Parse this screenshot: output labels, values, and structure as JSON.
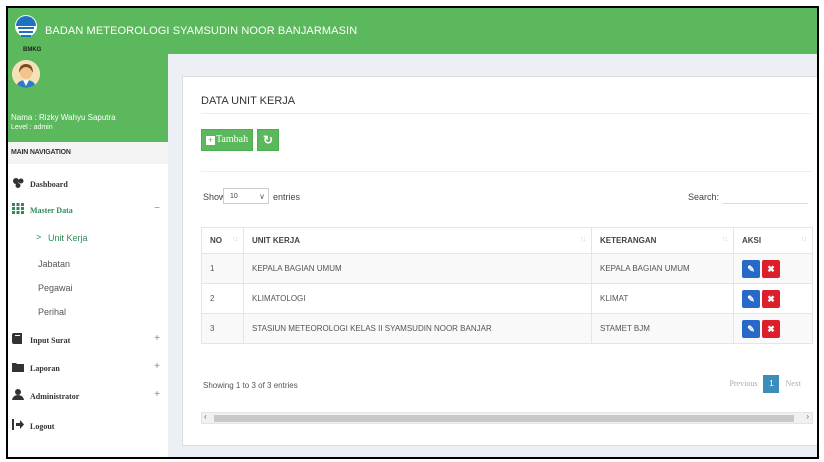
{
  "header": {
    "logo_text": "BMKG",
    "title": "BADAN METEOROLOGI SYAMSUDIN NOOR BANJARMASIN"
  },
  "user": {
    "name": "Nama : Rizky Wahyu Saputra",
    "level": "Level : admin"
  },
  "sidebar": {
    "nav_header": "MAIN NAVIGATION",
    "items": [
      {
        "label": "Dashboard",
        "icon": "dashboard-icon"
      },
      {
        "label": "Master Data",
        "icon": "grid-icon",
        "toggle": "−"
      },
      {
        "label": "Input Surat",
        "icon": "book-icon",
        "toggle": "+"
      },
      {
        "label": "Laporan",
        "icon": "folder-icon",
        "toggle": "+"
      },
      {
        "label": "Administrator",
        "icon": "user-icon",
        "toggle": "+"
      },
      {
        "label": "Logout",
        "icon": "logout-icon"
      }
    ],
    "master_sub": [
      "Unit Kerja",
      "Jabatan",
      "Pegawai",
      "Perihal"
    ]
  },
  "main": {
    "title": "DATA UNIT KERJA",
    "add_button": "Tambah",
    "show_label": "Show",
    "show_value": "10",
    "entries_label": "entries",
    "search_label": "Search:",
    "columns": [
      "NO",
      "UNIT KERJA",
      "KETERANGAN",
      "AKSI"
    ],
    "rows": [
      {
        "no": "1",
        "unit": "KEPALA BAGIAN UMUM",
        "ket": "KEPALA BAGIAN UMUM"
      },
      {
        "no": "2",
        "unit": "KLIMATOLOGI",
        "ket": "KLIMAT"
      },
      {
        "no": "3",
        "unit": "STASIUN METEOROLOGI KELAS II SYAMSUDIN NOOR BANJAR",
        "ket": "STAMET BJM"
      }
    ],
    "info": "Showing 1 to 3 of 3 entries",
    "pagination": {
      "previous": "Previous",
      "current": "1",
      "next": "Next"
    }
  },
  "colors": {
    "primary_green": "#5cb85c",
    "edit_blue": "#2769c8",
    "delete_red": "#dd1f2b",
    "page_blue": "#3c8dbc"
  }
}
